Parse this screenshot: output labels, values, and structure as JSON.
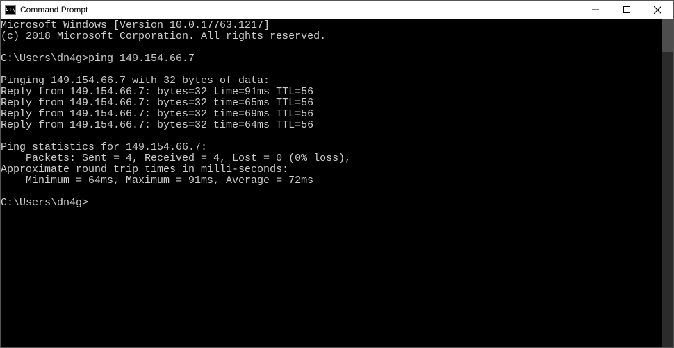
{
  "window": {
    "icon_text": "C:\\",
    "title": "Command Prompt"
  },
  "terminal": {
    "lines": [
      "Microsoft Windows [Version 10.0.17763.1217]",
      "(c) 2018 Microsoft Corporation. All rights reserved.",
      "",
      "C:\\Users\\dn4g>ping 149.154.66.7",
      "",
      "Pinging 149.154.66.7 with 32 bytes of data:",
      "Reply from 149.154.66.7: bytes=32 time=91ms TTL=56",
      "Reply from 149.154.66.7: bytes=32 time=65ms TTL=56",
      "Reply from 149.154.66.7: bytes=32 time=69ms TTL=56",
      "Reply from 149.154.66.7: bytes=32 time=64ms TTL=56",
      "",
      "Ping statistics for 149.154.66.7:",
      "    Packets: Sent = 4, Received = 4, Lost = 0 (0% loss),",
      "Approximate round trip times in milli-seconds:",
      "    Minimum = 64ms, Maximum = 91ms, Average = 72ms",
      "",
      "C:\\Users\\dn4g>"
    ]
  }
}
